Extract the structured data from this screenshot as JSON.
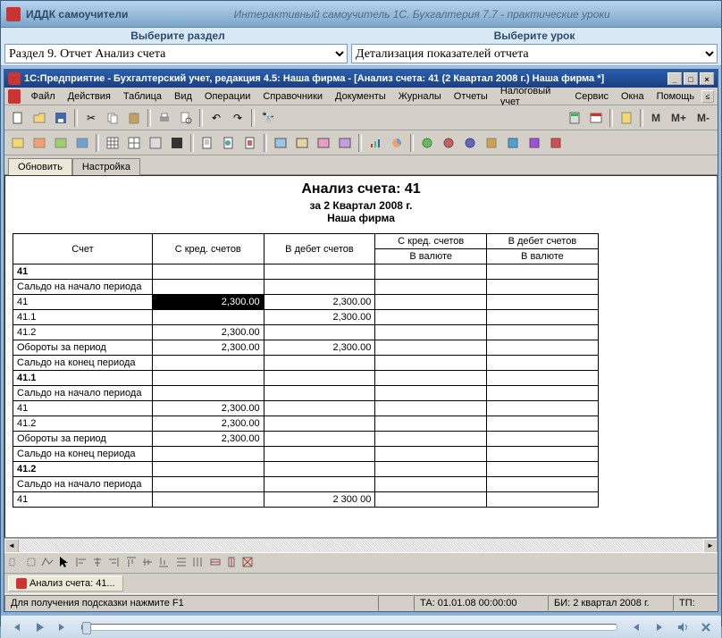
{
  "outer": {
    "app_name": "ИДДК самоучители",
    "subtitle": "Интерактивный самоучитель 1С. Бухгалтерия 7.7 - практические уроки"
  },
  "selector": {
    "label_section": "Выберите раздел",
    "label_lesson": "Выберите урок",
    "section_value": "Раздел 9. Отчет Анализ счета",
    "lesson_value": "Детализация показателей отчета"
  },
  "inner": {
    "title": "1С:Предприятие - Бухгалтерский учет, редакция 4.5: Наша фирма - [Анализ счета: 41 (2 Квартал 2008 г.) Наша фирма  *]"
  },
  "menu": {
    "items": [
      "Файл",
      "Действия",
      "Таблица",
      "Вид",
      "Операции",
      "Справочники",
      "Документы",
      "Журналы",
      "Отчеты",
      "Налоговый учет",
      "Сервис",
      "Окна",
      "Помощь"
    ]
  },
  "tabs": {
    "refresh": "Обновить",
    "settings": "Настройка"
  },
  "report": {
    "title": "Анализ счета: 41",
    "period": "за 2 Квартал 2008 г.",
    "firm": "Наша фирма",
    "headers": {
      "account": "Счет",
      "from_credit": "С кред. счетов",
      "to_debit": "В дебет счетов",
      "from_credit_cur": "С кред. счетов",
      "to_debit_cur": "В дебет счетов",
      "in_currency": "В валюте"
    },
    "rows": [
      {
        "acc": "41",
        "c1": "",
        "c2": "",
        "bold": true
      },
      {
        "acc": "Сальдо на начало периода",
        "c1": "",
        "c2": ""
      },
      {
        "acc": "41",
        "c1": "2,300.00",
        "c2": "2,300.00",
        "sel": true
      },
      {
        "acc": "41.1",
        "c1": "",
        "c2": "2,300.00"
      },
      {
        "acc": "41.2",
        "c1": "2,300.00",
        "c2": ""
      },
      {
        "acc": "Обороты за период",
        "c1": "2,300.00",
        "c2": "2,300.00"
      },
      {
        "acc": "Сальдо на конец периода",
        "c1": "",
        "c2": ""
      },
      {
        "acc": "41.1",
        "c1": "",
        "c2": "",
        "bold": true
      },
      {
        "acc": "Сальдо на начало периода",
        "c1": "",
        "c2": ""
      },
      {
        "acc": "41",
        "c1": "2,300.00",
        "c2": ""
      },
      {
        "acc": "41.2",
        "c1": "2,300.00",
        "c2": ""
      },
      {
        "acc": "Обороты за период",
        "c1": "2,300.00",
        "c2": ""
      },
      {
        "acc": "Сальдо на конец периода",
        "c1": "",
        "c2": ""
      },
      {
        "acc": "41.2",
        "c1": "",
        "c2": "",
        "bold": true
      },
      {
        "acc": "Сальдо на начало периода",
        "c1": "",
        "c2": ""
      },
      {
        "acc": "41",
        "c1": "",
        "c2": "2 300 00"
      }
    ]
  },
  "doc_tab": "Анализ счета: 41...",
  "status": {
    "hint": "Для получения подсказки нажмите F1",
    "ta": "ТА: 01.01.08  00:00:00",
    "bi": "БИ: 2 квартал 2008 г.",
    "tp": "ТП:"
  },
  "toolbar_text": {
    "m": "M",
    "mplus": "M+",
    "mminus": "M-"
  }
}
